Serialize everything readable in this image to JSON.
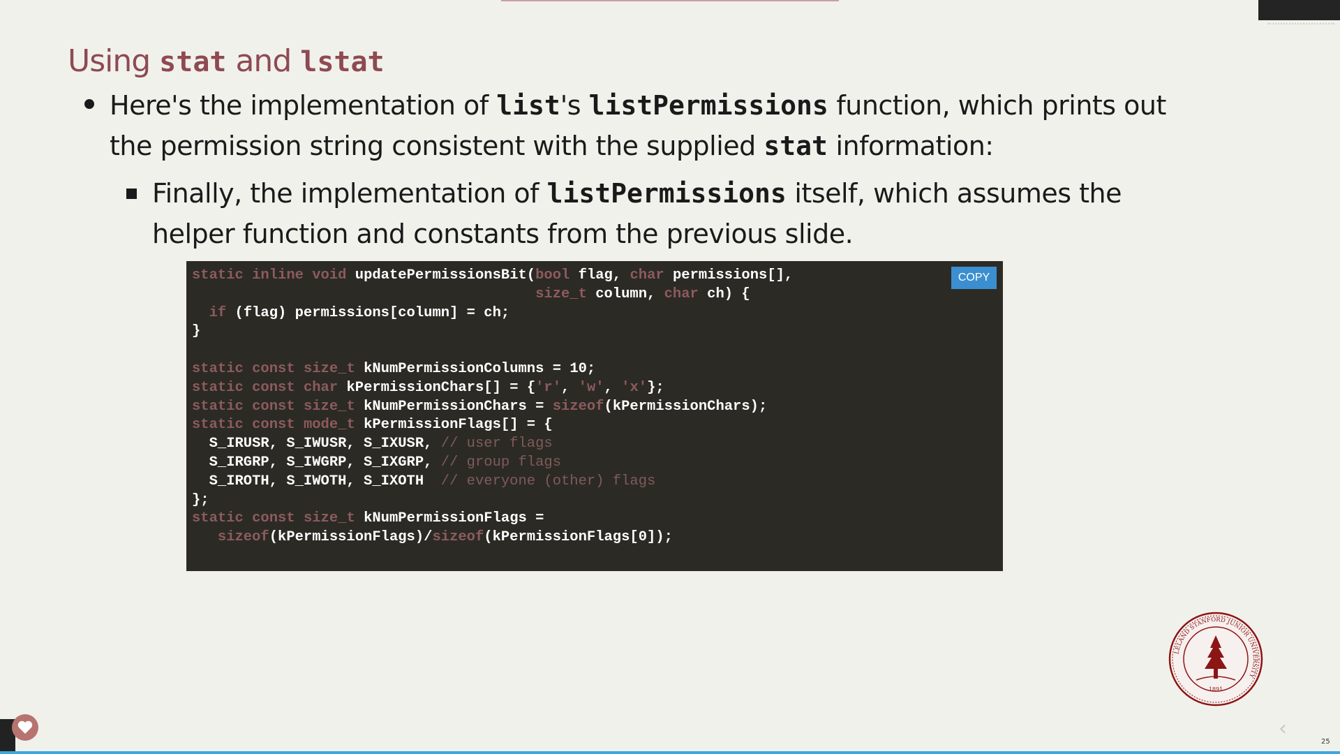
{
  "slide": {
    "title_prefix": "Using ",
    "title_code1": "stat",
    "title_mid": " and ",
    "title_code2": "lstat",
    "bullet1": {
      "t1": "Here's the implementation of ",
      "c1": "list",
      "t2": "'s ",
      "c2": "listPermissions",
      "t3": "  function, which prints out",
      "line2a": "the permission string consistent with the supplied ",
      "c3": "stat",
      "t4": "  information:"
    },
    "bullet2": {
      "t1": "Finally, the implementation of ",
      "c1": "listPermissions",
      "t2": "  itself, which assumes the",
      "line2": "helper function and constants from the previous slide."
    },
    "copy_label": "COPY",
    "page_number": "25"
  },
  "code_lines": [
    "static inline void updatePermissionsBit(bool flag, char permissions[],",
    "                                        size_t column, char ch) {",
    "  if (flag) permissions[column] = ch;",
    "}",
    "",
    "static const size_t kNumPermissionColumns = 10;",
    "static const char kPermissionChars[] = {'r', 'w', 'x'};",
    "static const size_t kNumPermissionChars = sizeof(kPermissionChars);",
    "static const mode_t kPermissionFlags[] = {",
    "  S_IRUSR, S_IWUSR, S_IXUSR, // user flags",
    "  S_IRGRP, S_IWGRP, S_IXGRP, // group flags",
    "  S_IROTH, S_IWOTH, S_IXOTH  // everyone (other) flags",
    "};",
    "static const size_t kNumPermissionFlags =",
    "   sizeof(kPermissionFlags)/sizeof(kPermissionFlags[0]);"
  ],
  "code_keywords": [
    "static",
    "inline",
    "void",
    "bool",
    "char",
    "size_t",
    "if",
    "const",
    "sizeof",
    "mode_t"
  ],
  "seal": {
    "ring_text": "LELAND STANFORD JUNIOR UNIVERSITY",
    "year": "1891"
  },
  "icons": {
    "heart": "heart-icon",
    "nav_prev": "chevron-left-icon"
  },
  "colors": {
    "title": "#8e4a52",
    "code_bg": "#2c2a24",
    "keyword": "#8c5b5e",
    "copy_button": "#3b8fd0",
    "progress": "#3fa7dc"
  }
}
